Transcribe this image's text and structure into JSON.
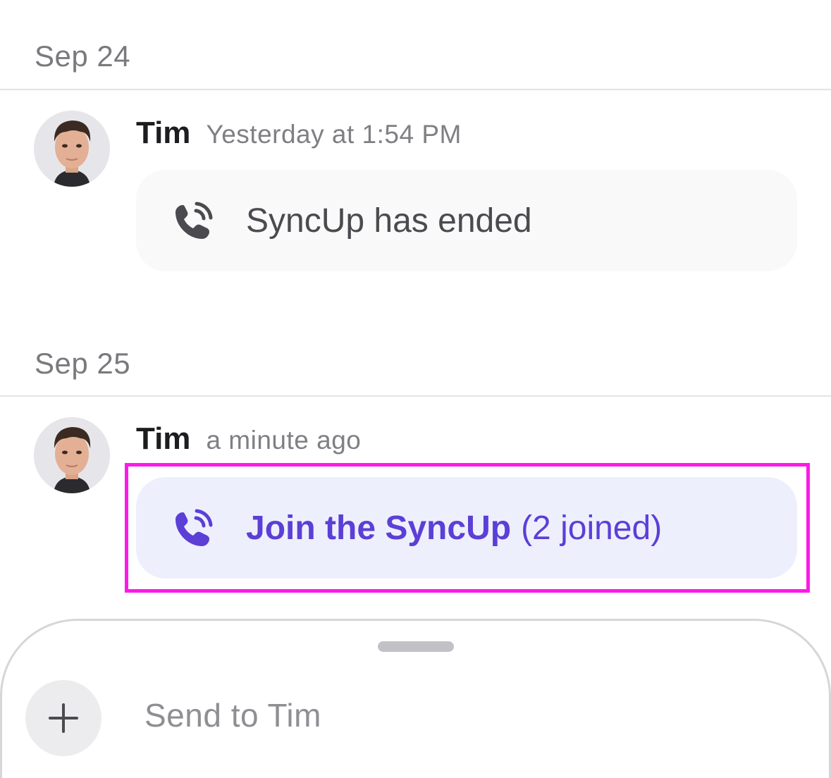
{
  "dates": [
    {
      "label": "Sep 24"
    },
    {
      "label": "Sep 25"
    }
  ],
  "messages": [
    {
      "sender": "Tim",
      "timestamp": "Yesterday at 1:54 PM",
      "call_status": "SyncUp has ended",
      "icon": "phone-call-icon"
    },
    {
      "sender": "Tim",
      "timestamp": "a minute ago",
      "join_label": "Join the SyncUp",
      "join_count": "(2 joined)",
      "icon": "phone-call-icon"
    }
  ],
  "compose": {
    "placeholder": "Send to Tim",
    "add_icon": "plus-icon"
  },
  "colors": {
    "accent": "#5b3fd6",
    "join_bubble": "#eeeffc",
    "highlight": "#ff19e8"
  }
}
